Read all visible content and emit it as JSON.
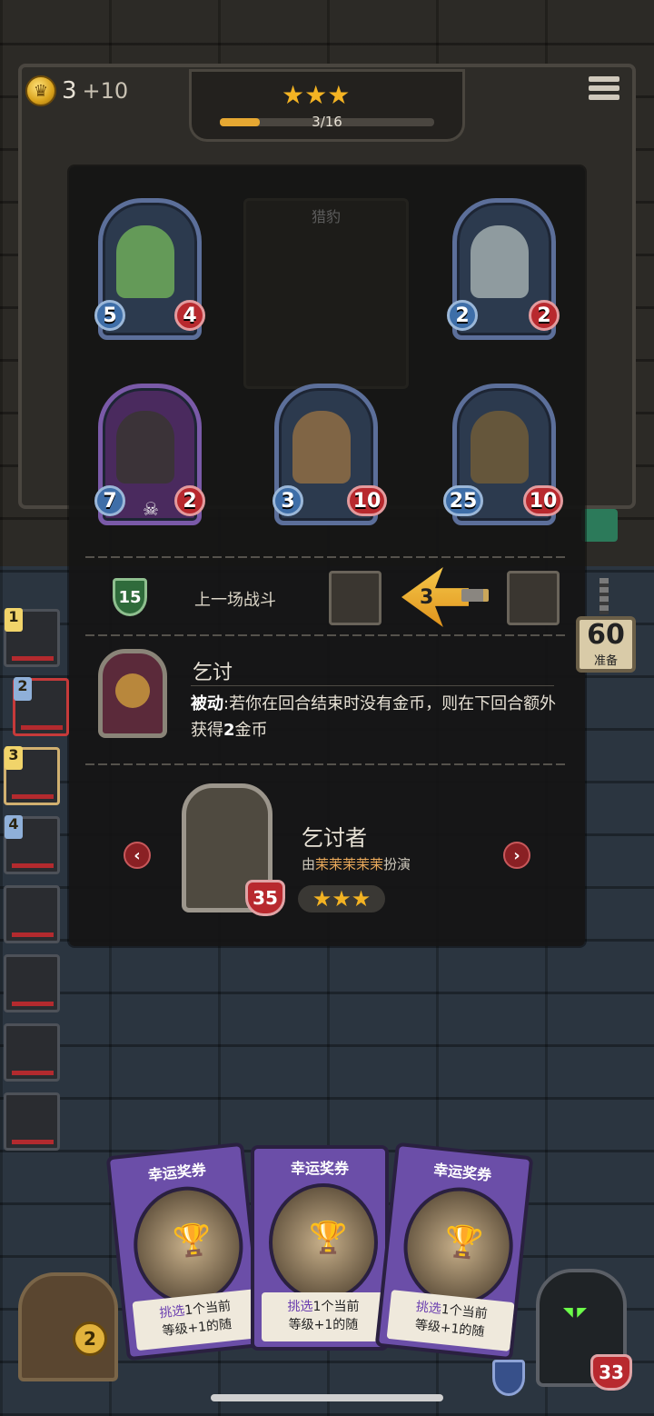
{
  "gold": {
    "amount": "3",
    "income": "+10"
  },
  "tier": {
    "stars": "★★★",
    "progress_text": "3/16",
    "progress_fraction": 0.1875
  },
  "faded_card": {
    "title": "猎豹"
  },
  "warband_minions": [
    {
      "attack": "5",
      "health": "4",
      "color": "#6aa55a"
    },
    {
      "attack": "2",
      "health": "2",
      "color": "#9aa6a8"
    },
    {
      "attack": "7",
      "health": "2",
      "color": "#7a4a8a",
      "has_skull": true
    },
    {
      "attack": "3",
      "health": "10",
      "color": "#8a6a45"
    },
    {
      "attack": "25",
      "health": "10",
      "color": "#6b5a3a"
    }
  ],
  "last_battle": {
    "shield_value": "15",
    "label": "上一场战斗",
    "damage": "3"
  },
  "ability": {
    "title": "乞讨",
    "keyword": "被动",
    "text": ":若你在回合结束时没有金币，则在下回合额外获得",
    "amount": "2",
    "suffix": "金币"
  },
  "hero": {
    "name": "乞讨者",
    "by_prefix": "由",
    "player": "茉茉茉茉茉",
    "by_suffix": "扮演",
    "health": "35",
    "stars": "★★★"
  },
  "sidebar_slots": [
    "1",
    "2",
    "3",
    "4",
    "",
    "",
    "",
    ""
  ],
  "timer": {
    "value": "60",
    "label": "准备"
  },
  "spell_cards": [
    {
      "name": "幸运奖券",
      "desc_line1_a": "挑选",
      "desc_line1_b": "1个当前",
      "desc_line2": "等级+1的随"
    },
    {
      "name": "幸运奖券",
      "desc_line1_a": "挑选",
      "desc_line1_b": "1个当前",
      "desc_line2": "等级+1的随"
    },
    {
      "name": "幸运奖券",
      "desc_line1_a": "挑选",
      "desc_line1_b": "1个当前",
      "desc_line2": "等级+1的随"
    }
  ],
  "refresh_cost": "2",
  "player_hero_health": "33"
}
